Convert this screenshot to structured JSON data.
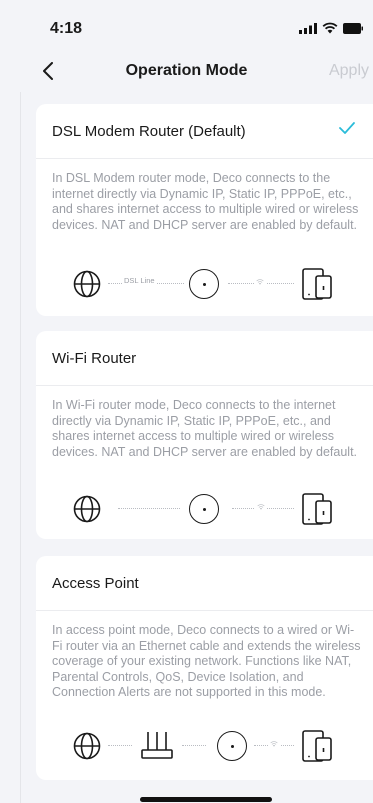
{
  "status": {
    "time": "4:18"
  },
  "nav": {
    "title": "Operation Mode",
    "apply": "Apply"
  },
  "modes": [
    {
      "title": "DSL Modem Router (Default)",
      "selected": true,
      "description": "In DSL Modem router mode, Deco connects to the internet directly via Dynamic IP, Static IP, PPPoE, etc., and shares internet access to multiple wired or wireless devices. NAT and DHCP server are enabled by default.",
      "diagram_label": "DSL Line"
    },
    {
      "title": "Wi-Fi Router",
      "selected": false,
      "description": "In Wi-Fi router mode, Deco connects to the internet directly via Dynamic IP, Static IP, PPPoE, etc., and shares internet access to multiple wired or wireless devices. NAT and DHCP server are enabled by default."
    },
    {
      "title": "Access Point",
      "selected": false,
      "description": "In access point mode, Deco connects to a wired or Wi-Fi router via an Ethernet cable and extends the wireless coverage of your existing network. Functions like NAT, Parental Controls, QoS, Device Isolation, and Connection Alerts are not supported in this mode."
    }
  ],
  "colors": {
    "accent": "#2bbcd9",
    "text": "#1a1a1a",
    "muted": "#9b9ea5",
    "disabled": "#c9cbd1",
    "background": "#f3f4f8"
  }
}
